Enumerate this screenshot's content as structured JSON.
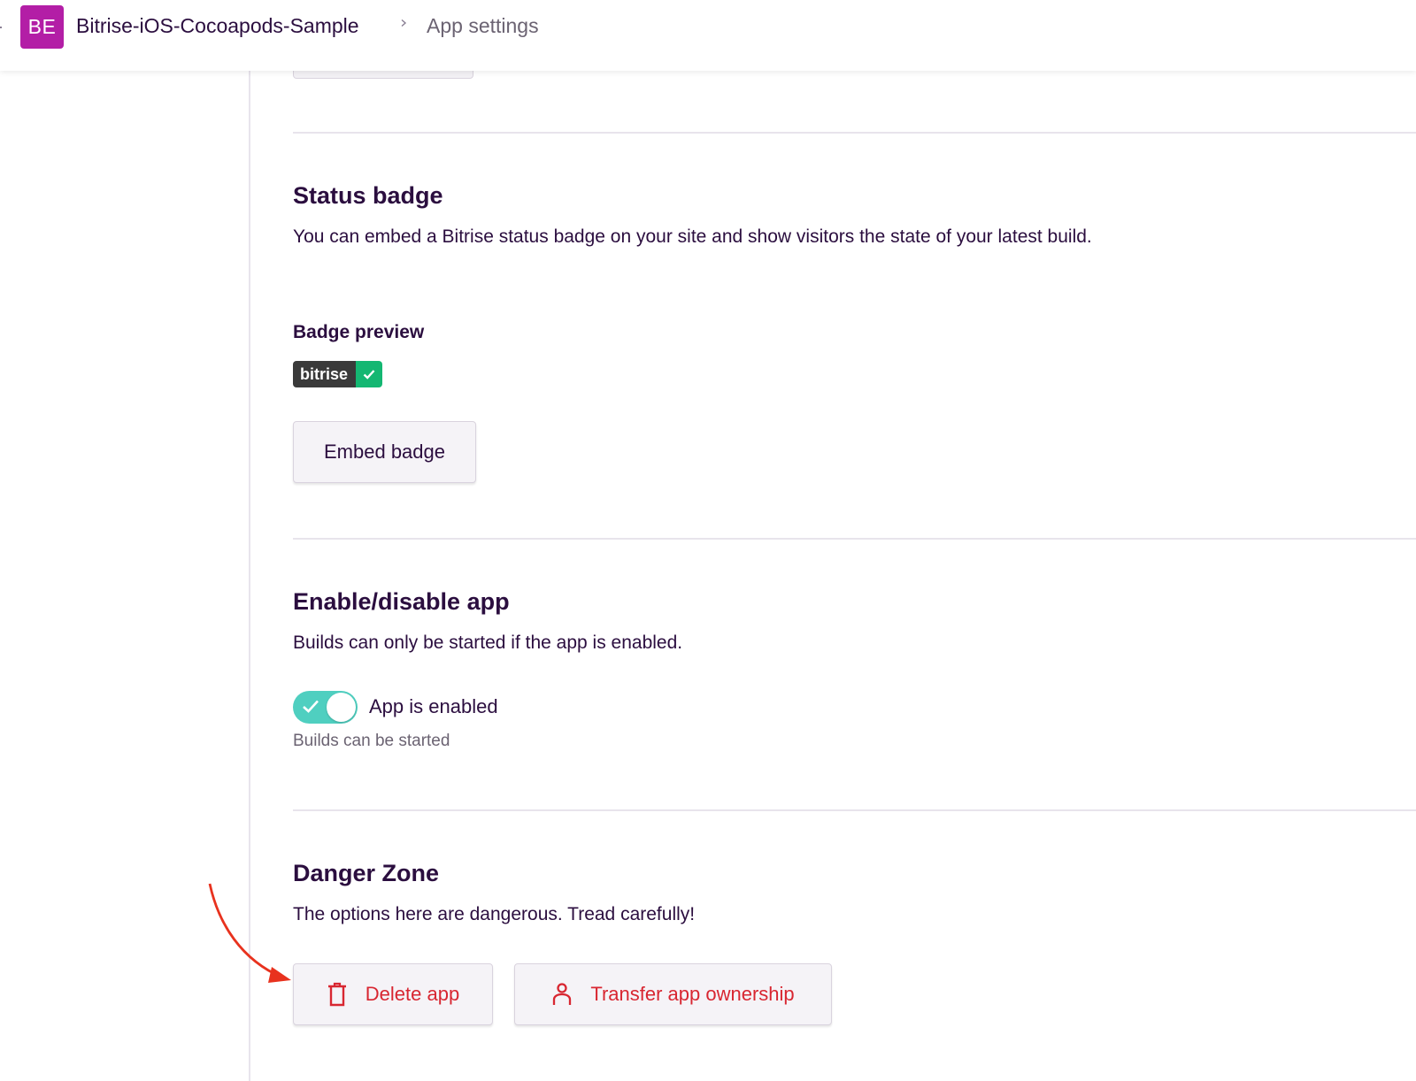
{
  "header": {
    "avatar_initials": "BE",
    "app_name": "Bitrise-iOS-Cocoapods-Sample",
    "breadcrumb_current": "App settings",
    "avatar_color": "#b31ea6"
  },
  "status_badge": {
    "title": "Status badge",
    "description": "You can embed a Bitrise status badge on your site and show visitors the state of your latest build.",
    "preview_label": "Badge preview",
    "badge_text": "bitrise",
    "badge_status_color": "#14b772",
    "embed_button": "Embed badge"
  },
  "enable_app": {
    "title": "Enable/disable app",
    "description": "Builds can only be started if the app is enabled.",
    "toggle_on": true,
    "toggle_color": "#4fcfc0",
    "toggle_label": "App is enabled",
    "toggle_help": "Builds can be started"
  },
  "danger_zone": {
    "title": "Danger Zone",
    "description": "The options here are dangerous. Tread carefully!",
    "delete_button": "Delete app",
    "delete_icon": "trash-icon",
    "transfer_button": "Transfer app ownership",
    "transfer_icon": "user-icon",
    "danger_color": "#d82631"
  },
  "annotation": {
    "arrow_color": "#e8321e"
  }
}
